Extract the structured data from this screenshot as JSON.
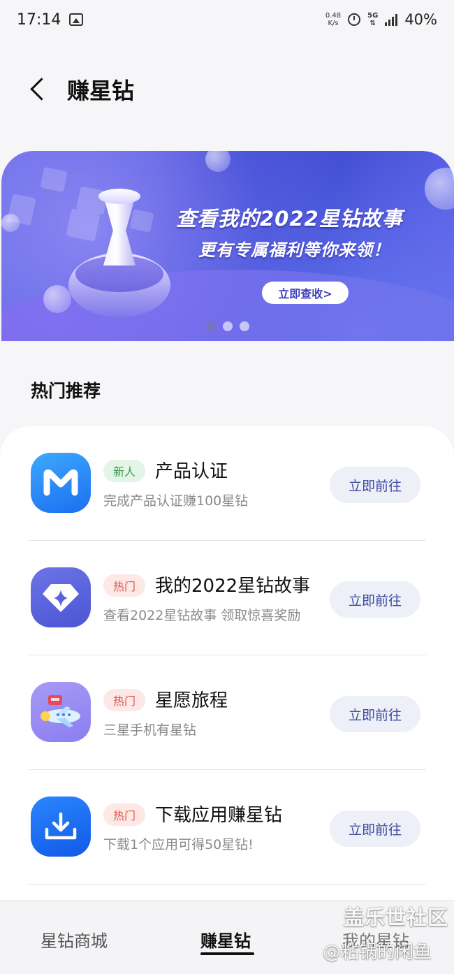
{
  "status_bar": {
    "time": "17:14",
    "net_speed_value": "0.48",
    "net_speed_unit": "K/s",
    "net_type": "5G",
    "battery": "40%"
  },
  "header": {
    "title": "赚星钻"
  },
  "banner": {
    "title": "查看我的2022星钻故事",
    "subtitle": "更有专属福利等你来领！",
    "cta": "立即查收>",
    "pages": 3,
    "active_page": 0
  },
  "section": {
    "title": "热门推荐"
  },
  "items": [
    {
      "icon": "m-logo-icon",
      "tag": "新人",
      "title": "产品认证",
      "desc": "完成产品认证赚100星钻",
      "button": "立即前往"
    },
    {
      "icon": "diamond-star-icon",
      "tag": "热门",
      "title": "我的2022星钻故事",
      "desc": "查看2022星钻故事 领取惊喜奖励",
      "button": "立即前往"
    },
    {
      "icon": "airplane-travel-icon",
      "tag": "热门",
      "title": "星愿旅程",
      "desc": "三星手机有星钻",
      "button": "立即前往"
    },
    {
      "icon": "download-tray-icon",
      "tag": "热门",
      "title": "下载应用赚星钻",
      "desc": "下载1个应用可得50星钻!",
      "button": "立即前往"
    }
  ],
  "bottom_nav": {
    "shop": "星钻商城",
    "earn": "赚星钻",
    "mine": "我的星钻",
    "active": "earn"
  },
  "watermark": {
    "line1": "盖乐世社区",
    "line2": "@粘锅的闲鱼"
  },
  "colors": {
    "accent_button_text": "#3c4aa0",
    "tag_new": "#3a9a4e",
    "tag_hot": "#d9574a"
  }
}
